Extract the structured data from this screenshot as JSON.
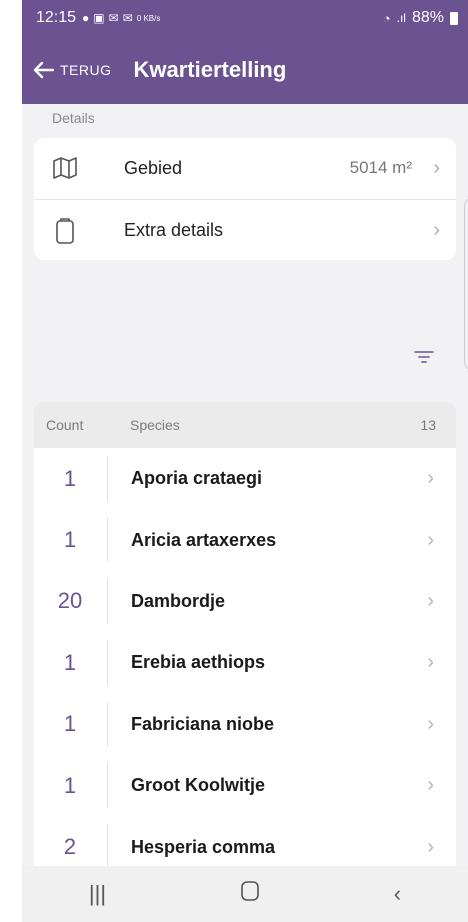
{
  "status_bar": {
    "time": "12:15",
    "battery": "88%",
    "speed": "0 KB/s"
  },
  "app_bar": {
    "back_label": "TERUG",
    "title": "Kwartiertelling"
  },
  "details": {
    "section_label": "Details",
    "area_label": "Gebied",
    "area_value": "5014 m²",
    "extra_label": "Extra details"
  },
  "species_list": {
    "header_count": "Count",
    "header_species": "Species",
    "header_total": "13",
    "rows": [
      {
        "count": "1",
        "name": "Aporia crataegi"
      },
      {
        "count": "1",
        "name": "Aricia artaxerxes"
      },
      {
        "count": "20",
        "name": "Dambordje"
      },
      {
        "count": "1",
        "name": "Erebia aethiops"
      },
      {
        "count": "1",
        "name": "Fabriciana niobe"
      },
      {
        "count": "1",
        "name": "Groot Koolwitje"
      },
      {
        "count": "2",
        "name": "Hesperia comma"
      }
    ]
  },
  "nav": {
    "recent_icon": "recents-icon",
    "home_icon": "home-icon",
    "back_icon": "back-icon"
  },
  "colors": {
    "primary": "#6b5392",
    "background": "#f2f1f4"
  }
}
